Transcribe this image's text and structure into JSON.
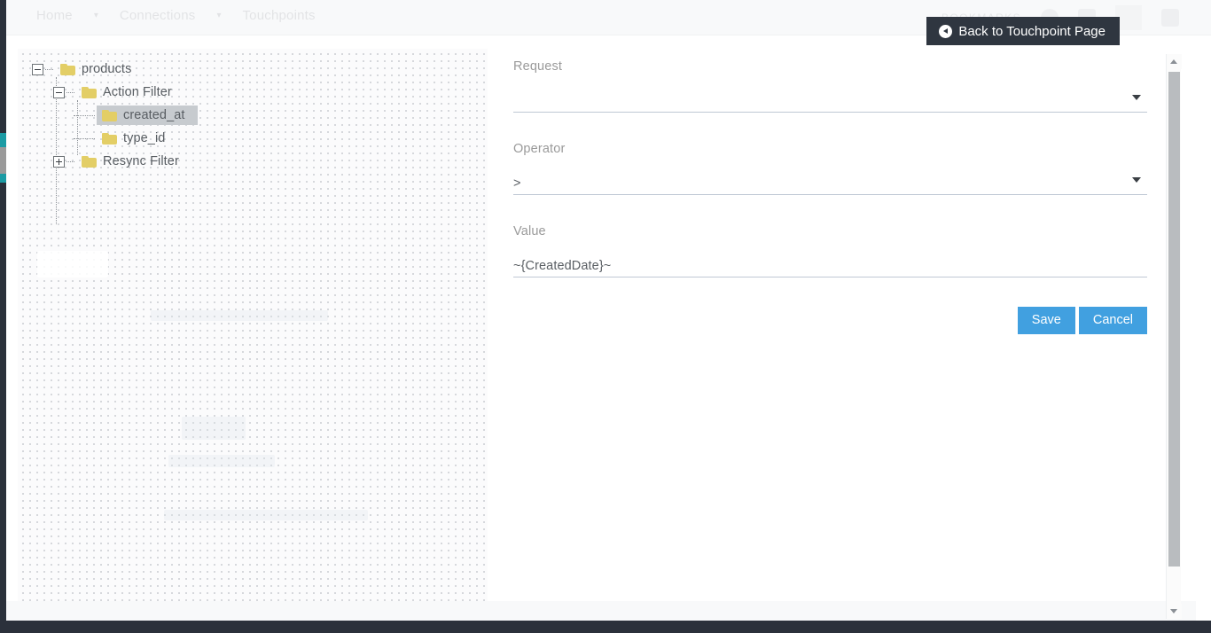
{
  "topnav": {
    "items": [
      {
        "label": "Home",
        "icon": ""
      },
      {
        "label": "Connections",
        "icon": "chevron-down-icon"
      },
      {
        "label": "Touchpoints",
        "icon": ""
      }
    ],
    "caret": "⌄",
    "bookmarks_label": "BOOKMARKS"
  },
  "header": {
    "back_button_label": "Back to Touchpoint Page",
    "back_button_icon": "arrow-left-circle-icon",
    "back_button_bg": "#2f3640"
  },
  "tree": {
    "nodes": [
      {
        "label": "products",
        "level": 0,
        "toggle": "minus",
        "icon": "folder-icon",
        "selected": false
      },
      {
        "label": "Action Filter",
        "level": 1,
        "toggle": "minus",
        "icon": "folder-icon",
        "selected": false
      },
      {
        "label": "created_at",
        "level": 2,
        "toggle": "none",
        "icon": "folder-icon",
        "selected": true
      },
      {
        "label": "type_id",
        "level": 2,
        "toggle": "none",
        "icon": "folder-icon",
        "selected": false
      },
      {
        "label": "Resync Filter",
        "level": 1,
        "toggle": "plus",
        "icon": "folder-icon",
        "selected": false
      }
    ],
    "folder_color": "#e3ce66",
    "selection_color": "#c7cbcf"
  },
  "form": {
    "fields": [
      {
        "label": "Request",
        "value": "",
        "control": "select",
        "caret": "chevron-down-icon"
      },
      {
        "label": "Operator",
        "value": ">",
        "control": "select",
        "caret": "chevron-down-icon"
      },
      {
        "label": "Value",
        "value": "~{CreatedDate}~",
        "control": "text",
        "caret": ""
      }
    ],
    "save_label": "Save",
    "cancel_label": "Cancel",
    "button_color": "#41a0e0"
  },
  "scrollbar": {
    "up_icon": "triangle-up-icon",
    "down_icon": "triangle-down-icon",
    "thumb_name": "scrollbar-thumb"
  }
}
